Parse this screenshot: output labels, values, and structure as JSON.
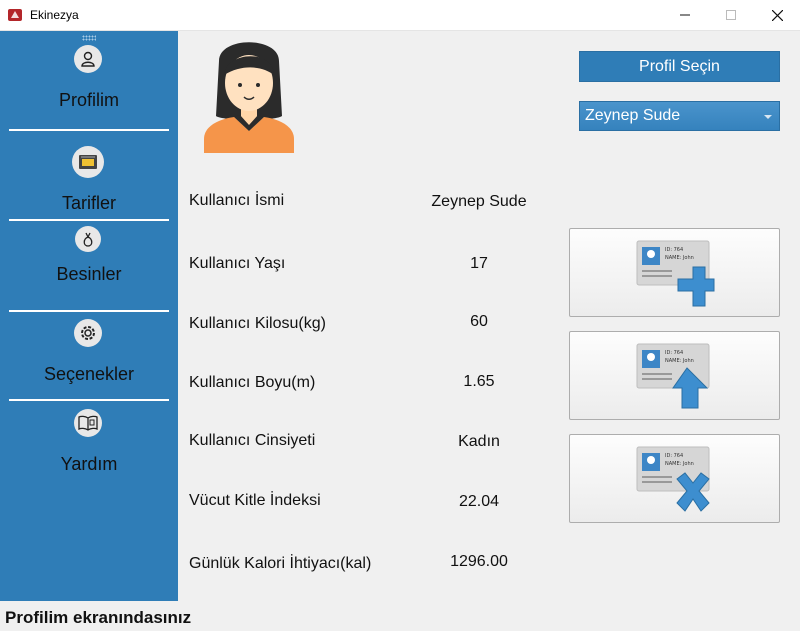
{
  "window": {
    "title": "Ekinezya",
    "icon": "app-logo-icon"
  },
  "sidebar": {
    "items": [
      {
        "label": "Profilim",
        "icon": "user-icon"
      },
      {
        "label": "Tarifler",
        "icon": "oven-icon"
      },
      {
        "label": "Besinler",
        "icon": "food-bag-icon"
      },
      {
        "label": "Seçenekler",
        "icon": "gear-icon"
      },
      {
        "label": "Yardım",
        "icon": "book-icon"
      }
    ]
  },
  "main": {
    "avatar_icon": "female-avatar-icon",
    "profile_button_label": "Profil Seçin",
    "profile_select_value": "Zeynep Sude",
    "fields": [
      {
        "label": "Kullanıcı İsmi",
        "value": "Zeynep Sude"
      },
      {
        "label": "Kullanıcı Yaşı",
        "value": "17"
      },
      {
        "label": "Kullanıcı Kilosu(kg)",
        "value": "60"
      },
      {
        "label": "Kullanıcı Boyu(m)",
        "value": "1.65"
      },
      {
        "label": "Kullanıcı Cinsiyeti",
        "value": "Kadın"
      },
      {
        "label": "Vücut Kitle İndeksi",
        "value": "22.04"
      },
      {
        "label": "Günlük Kalori İhtiyacı(kal)",
        "value": "1296.00"
      }
    ],
    "actions": [
      {
        "icon": "add-profile-icon"
      },
      {
        "icon": "update-profile-icon"
      },
      {
        "icon": "delete-profile-icon"
      }
    ],
    "id_card": {
      "id_text": "ID: 764",
      "name_text": "NAME: John"
    }
  },
  "status": {
    "text": "Profilim ekranındasınız"
  },
  "colors": {
    "sidebar": "#2f7db7",
    "accent": "#2f7db7",
    "panel": "#f0f0f0"
  }
}
